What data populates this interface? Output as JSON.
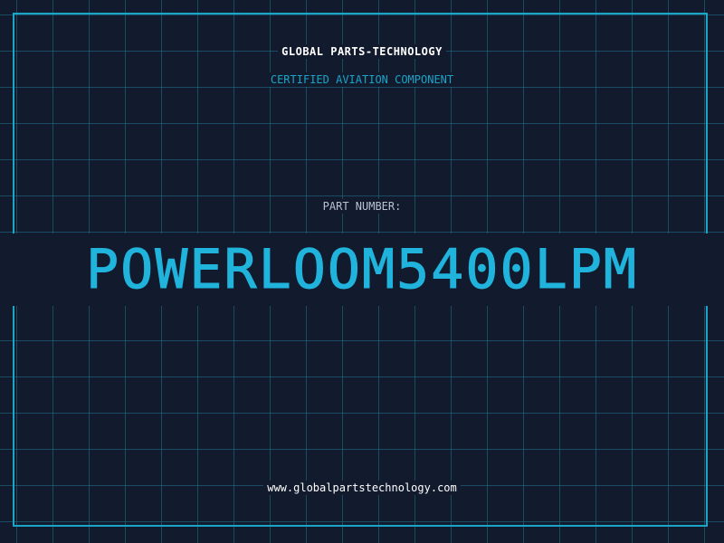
{
  "card": {
    "company_name": "GLOBAL PARTS-TECHNOLOGY",
    "subtitle": "CERTIFIED AVIATION COMPONENT",
    "part_label": "PART NUMBER:",
    "part_number": "POWERLOOM5400LPM",
    "website": "www.globalpartstechnology.com"
  },
  "colors": {
    "background": "#121a2e",
    "grid": "#20738c",
    "accent": "#1aa4c6",
    "part_number": "#20b4dc",
    "heading": "#ffffff",
    "label": "#b8c2d0"
  }
}
